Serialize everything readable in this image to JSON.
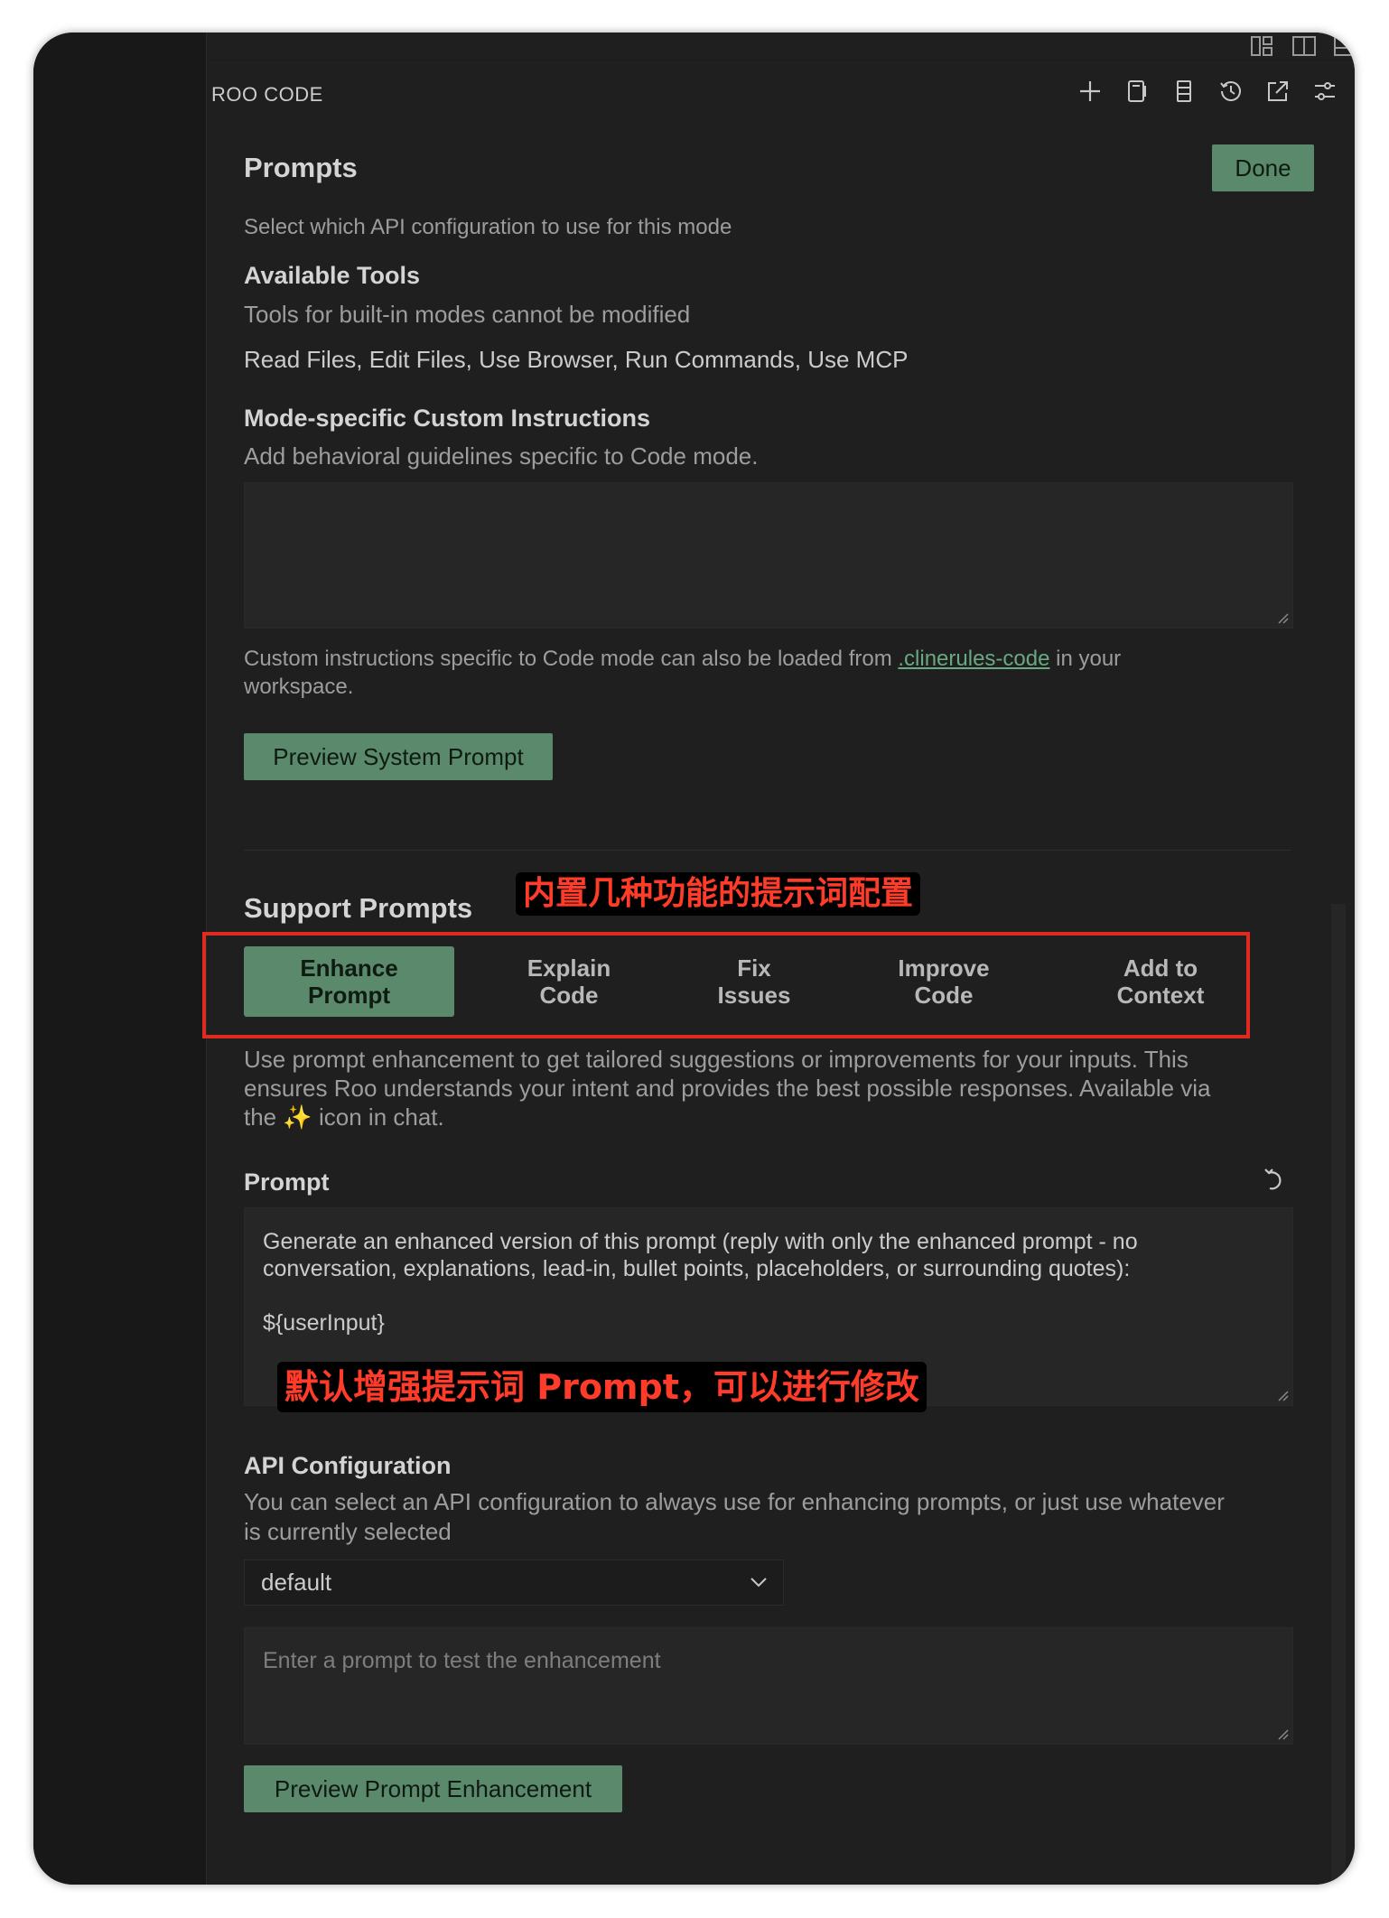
{
  "app": {
    "title": "ROO CODE"
  },
  "header": {
    "icons": [
      "plus-icon",
      "notebook-icon",
      "server-icon",
      "history-icon",
      "external-link-icon",
      "settings-sliders-icon"
    ]
  },
  "prompts": {
    "title": "Prompts",
    "done_label": "Done",
    "api_config_hint": "Select which API configuration to use for this mode",
    "tools_title": "Available Tools",
    "tools_hint": "Tools for built-in modes cannot be modified",
    "tools_list": "Read Files, Edit Files, Use Browser, Run Commands, Use MCP",
    "custom_title": "Mode-specific Custom Instructions",
    "custom_hint": "Add behavioral guidelines specific to Code mode.",
    "custom_value": "",
    "note_prefix": "Custom instructions specific to Code mode can also be loaded from",
    "note_link": ".clinerules-code",
    "note_suffix": "in your",
    "note_line2": "workspace.",
    "preview_system_label": "Preview System Prompt"
  },
  "support": {
    "title": "Support Prompts",
    "annotation_top": "内置几种功能的提示词配置",
    "tabs": [
      {
        "line1": "Enhance",
        "line2": "Prompt",
        "active": true
      },
      {
        "line1": "Explain",
        "line2": "Code",
        "active": false
      },
      {
        "line1": "Fix",
        "line2": "Issues",
        "active": false
      },
      {
        "line1": "Improve",
        "line2": "Code",
        "active": false
      },
      {
        "line1": "Add to",
        "line2": "Context",
        "active": false
      }
    ],
    "description_line1": "Use prompt enhancement to get tailored suggestions or improvements for your inputs. This",
    "description_line2": "ensures Roo understands your intent and provides the best possible responses. Available via",
    "description_line3_prefix": "the",
    "description_line3_suffix": "icon in chat.",
    "sparkle_glyph": "✨",
    "prompt_title": "Prompt",
    "prompt_line1": "Generate an enhanced version of this prompt (reply with only the enhanced prompt - no",
    "prompt_line2": "conversation, explanations, lead-in, bullet points, placeholders, or surrounding quotes):",
    "prompt_line3": "${userInput}",
    "annotation_bottom": "默认增强提示词 Prompt，可以进行修改",
    "api_title": "API Configuration",
    "api_hint_line1": "You can select an API configuration to always use for enhancing prompts, or just use whatever",
    "api_hint_line2": "is currently selected",
    "api_selected": "default",
    "test_placeholder": "Enter a prompt to test the enhancement",
    "preview_enh_label": "Preview Prompt Enhancement"
  },
  "colors": {
    "accent": "#5a8a6b",
    "annotation_red": "#e02a1f",
    "background": "#1f1f1f"
  }
}
